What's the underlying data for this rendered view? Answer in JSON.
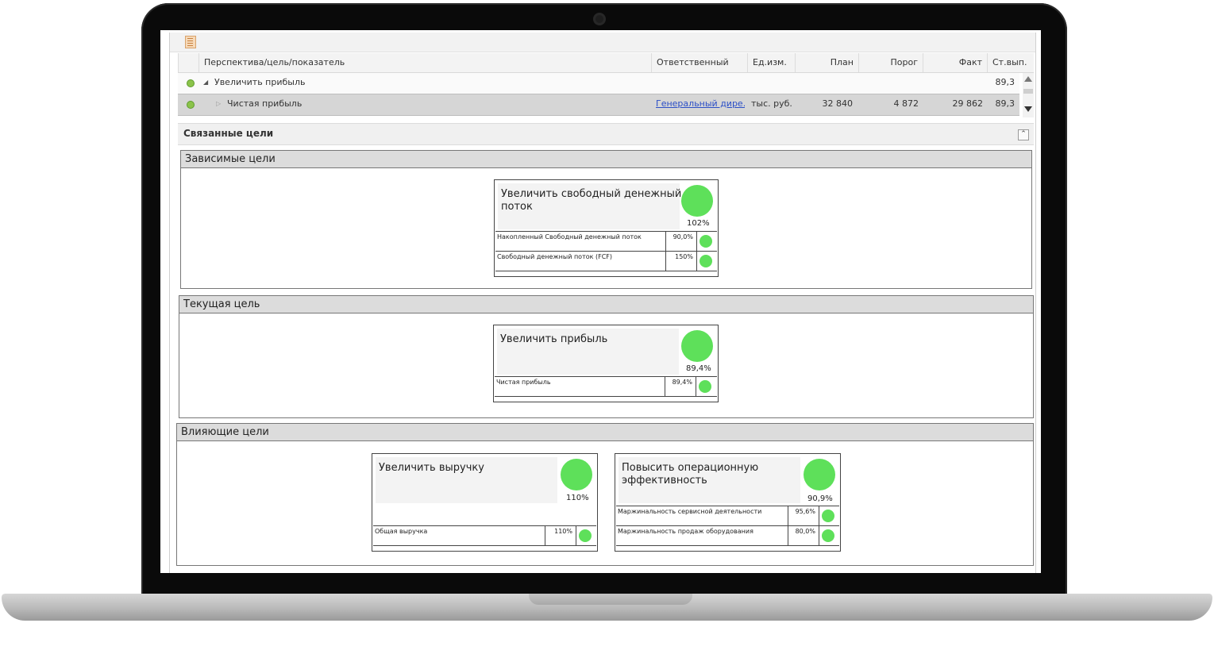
{
  "grid": {
    "columns": [
      "Перспектива/цель/показатель",
      "Ответственный",
      "Ед.изм.",
      "План",
      "Порог",
      "Факт",
      "Ст.вып."
    ],
    "rows": [
      {
        "name": "Увеличить прибыль",
        "responsible": "",
        "unit": "",
        "plan": "",
        "threshold": "",
        "fact": "",
        "pct": "89,3"
      },
      {
        "name": "Чистая прибыль",
        "responsible": "Генеральный дире...",
        "unit": "тыс. руб.",
        "plan": "32 840",
        "threshold": "4 872",
        "fact": "29 862",
        "pct": "89,3"
      }
    ]
  },
  "linked": {
    "title": "Связанные цели",
    "dependent": {
      "title": "Зависимые цели",
      "card": {
        "title": "Увеличить свободный денежный поток",
        "pct": "102%",
        "kpis": [
          {
            "name": "Накопленный Свободный денежный поток",
            "pct": "90,0%"
          },
          {
            "name": "Свободный денежный поток (FCF)",
            "pct": "150%"
          }
        ]
      }
    },
    "current": {
      "title": "Текущая цель",
      "card": {
        "title": "Увеличить прибыль",
        "pct": "89,4%",
        "kpis": [
          {
            "name": "Чистая прибыль",
            "pct": "89,4%"
          }
        ]
      }
    },
    "influencing": {
      "title": "Влияющие цели",
      "cards": [
        {
          "title": "Увеличить выручку",
          "pct": "110%",
          "kpis": [
            {
              "name": "Общая выручка",
              "pct": "110%"
            }
          ]
        },
        {
          "title_line1": "Повысить операционную",
          "title_line2": "эффективность",
          "pct": "90,9%",
          "kpis": [
            {
              "name": "Маржинальность сервисной деятельности",
              "pct": "95,6%"
            },
            {
              "name": "Маржинальность продаж оборудования",
              "pct": "80,0%"
            }
          ]
        }
      ]
    }
  },
  "colors": {
    "status_green": "#5ee05a",
    "link": "#2b4fc7"
  },
  "icons": {
    "toolbar": "report-icon",
    "status": "status-dot-icon",
    "collapse": "double-chevron-up-icon"
  }
}
